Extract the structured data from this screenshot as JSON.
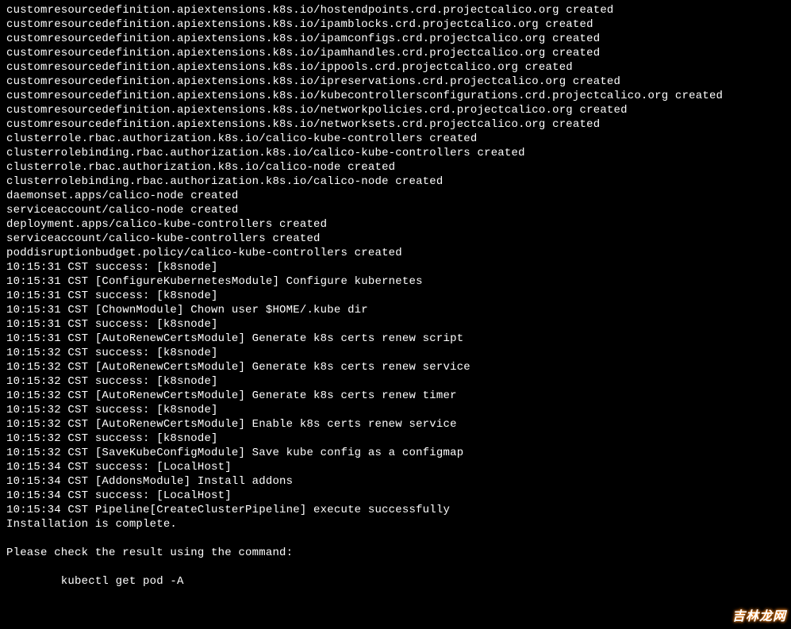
{
  "terminal": {
    "lines": [
      "customresourcedefinition.apiextensions.k8s.io/hostendpoints.crd.projectcalico.org created",
      "customresourcedefinition.apiextensions.k8s.io/ipamblocks.crd.projectcalico.org created",
      "customresourcedefinition.apiextensions.k8s.io/ipamconfigs.crd.projectcalico.org created",
      "customresourcedefinition.apiextensions.k8s.io/ipamhandles.crd.projectcalico.org created",
      "customresourcedefinition.apiextensions.k8s.io/ippools.crd.projectcalico.org created",
      "customresourcedefinition.apiextensions.k8s.io/ipreservations.crd.projectcalico.org created",
      "customresourcedefinition.apiextensions.k8s.io/kubecontrollersconfigurations.crd.projectcalico.org created",
      "customresourcedefinition.apiextensions.k8s.io/networkpolicies.crd.projectcalico.org created",
      "customresourcedefinition.apiextensions.k8s.io/networksets.crd.projectcalico.org created",
      "clusterrole.rbac.authorization.k8s.io/calico-kube-controllers created",
      "clusterrolebinding.rbac.authorization.k8s.io/calico-kube-controllers created",
      "clusterrole.rbac.authorization.k8s.io/calico-node created",
      "clusterrolebinding.rbac.authorization.k8s.io/calico-node created",
      "daemonset.apps/calico-node created",
      "serviceaccount/calico-node created",
      "deployment.apps/calico-kube-controllers created",
      "serviceaccount/calico-kube-controllers created",
      "poddisruptionbudget.policy/calico-kube-controllers created",
      "10:15:31 CST success: [k8snode]",
      "10:15:31 CST [ConfigureKubernetesModule] Configure kubernetes",
      "10:15:31 CST success: [k8snode]",
      "10:15:31 CST [ChownModule] Chown user $HOME/.kube dir",
      "10:15:31 CST success: [k8snode]",
      "10:15:31 CST [AutoRenewCertsModule] Generate k8s certs renew script",
      "10:15:32 CST success: [k8snode]",
      "10:15:32 CST [AutoRenewCertsModule] Generate k8s certs renew service",
      "10:15:32 CST success: [k8snode]",
      "10:15:32 CST [AutoRenewCertsModule] Generate k8s certs renew timer",
      "10:15:32 CST success: [k8snode]",
      "10:15:32 CST [AutoRenewCertsModule] Enable k8s certs renew service",
      "10:15:32 CST success: [k8snode]",
      "10:15:32 CST [SaveKubeConfigModule] Save kube config as a configmap",
      "10:15:34 CST success: [LocalHost]",
      "10:15:34 CST [AddonsModule] Install addons",
      "10:15:34 CST success: [LocalHost]",
      "10:15:34 CST Pipeline[CreateClusterPipeline] execute successfully",
      "Installation is complete.",
      "",
      "Please check the result using the command:",
      "",
      "        kubectl get pod -A",
      ""
    ]
  },
  "watermark": {
    "text": "吉林龙网"
  }
}
